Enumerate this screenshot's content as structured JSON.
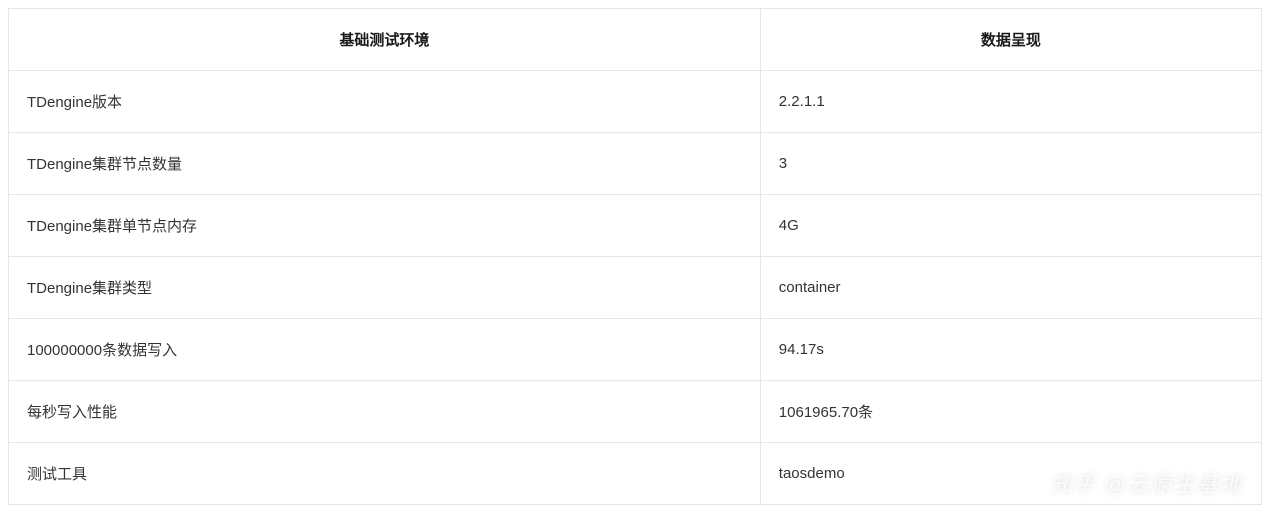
{
  "table": {
    "headers": [
      "基础测试环境",
      "数据呈现"
    ],
    "rows": [
      {
        "label": "TDengine版本",
        "value": "2.2.1.1"
      },
      {
        "label": "TDengine集群节点数量",
        "value": "3"
      },
      {
        "label": "TDengine集群单节点内存",
        "value": "4G"
      },
      {
        "label": "TDengine集群类型",
        "value": "container"
      },
      {
        "label": "100000000条数据写入",
        "value": "94.17s"
      },
      {
        "label": "每秒写入性能",
        "value": "1061965.70条"
      },
      {
        "label": "测试工具",
        "value": "taosdemo"
      }
    ]
  },
  "watermark": "知乎 @云原生基地"
}
